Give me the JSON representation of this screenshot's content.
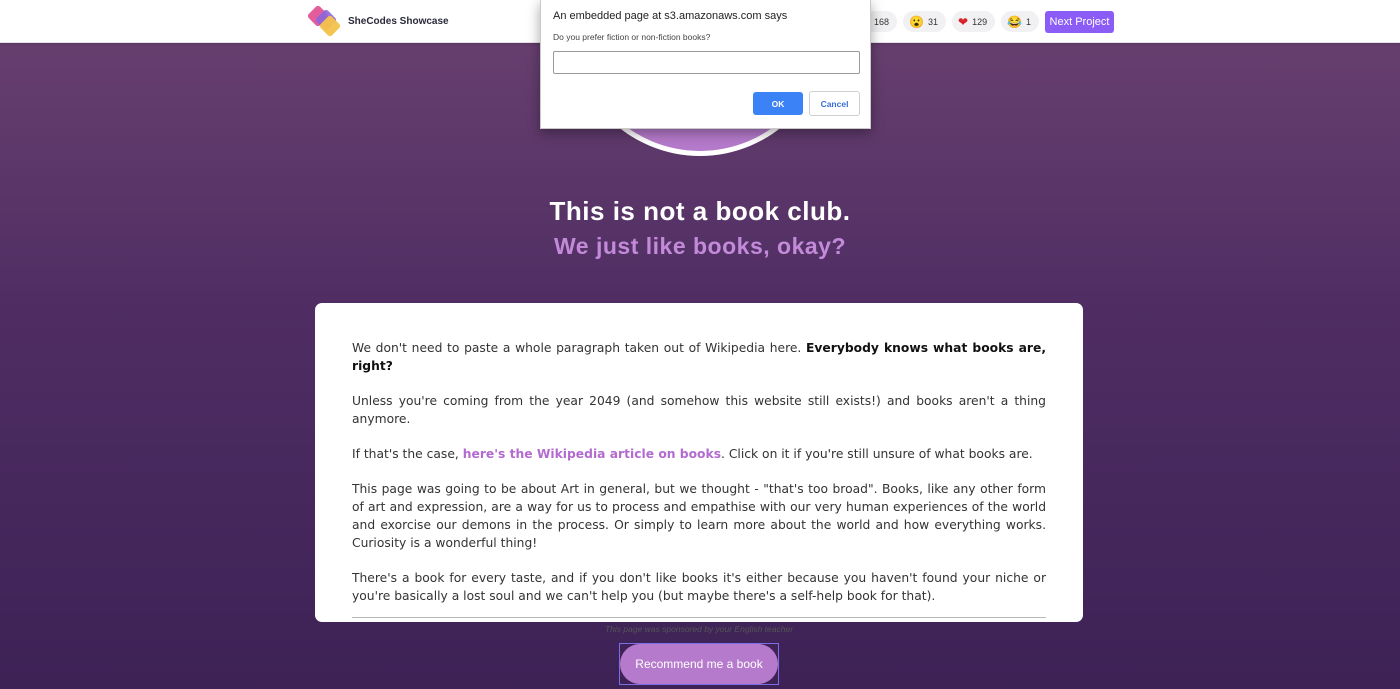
{
  "topbar": {
    "brand_name": "SheCodes Showcase",
    "reactions": [
      {
        "icon": "thumbs-up-icon",
        "count": "168"
      },
      {
        "icon": "surprised-face-icon",
        "emoji": "😮",
        "count": "31"
      },
      {
        "icon": "heart-icon",
        "emoji": "❤",
        "count": "129"
      },
      {
        "icon": "laughing-face-icon",
        "emoji": "😂",
        "count": "1"
      }
    ],
    "next_button": "Next Project",
    "accent_color": "#8b5cf6"
  },
  "hero": {
    "title": "This is not a book club.",
    "subtitle": "We just like books, okay?"
  },
  "card": {
    "p1_text": "We don't need to paste a whole paragraph taken out of Wikipedia here. ",
    "p1_bold": "Everybody knows what books are, right?",
    "p2": "Unless you're coming from the year 2049 (and somehow this website still exists!) and books aren't a thing anymore.",
    "p3_before": "If that's the case, ",
    "p3_link": "here's the Wikipedia article on books",
    "p3_after": ". Click on it if you're still unsure of what books are.",
    "p4": "This page was going to be about Art in general, but we thought - \"that's too broad\". Books, like any other form of art and expression, are a way for us to process and empathise with our very human experiences of the world and exorcise our demons in the process. Or simply to learn more about the world and how everything works. Curiosity is a wonderful thing!",
    "p5": "There's a book for every taste, and if you don't like books it's either because you haven't found your niche or you're basically a lost soul and we can't help you (but maybe there's a self-help book for that).",
    "sponsor": "This page was sponsored by your English teacher"
  },
  "cta": {
    "label": "Recommend me a book"
  },
  "dialog": {
    "title": "An embedded page at s3.amazonaws.com says",
    "message": "Do you prefer fiction or non-fiction books?",
    "input_value": "",
    "ok_label": "OK",
    "cancel_label": "Cancel"
  }
}
